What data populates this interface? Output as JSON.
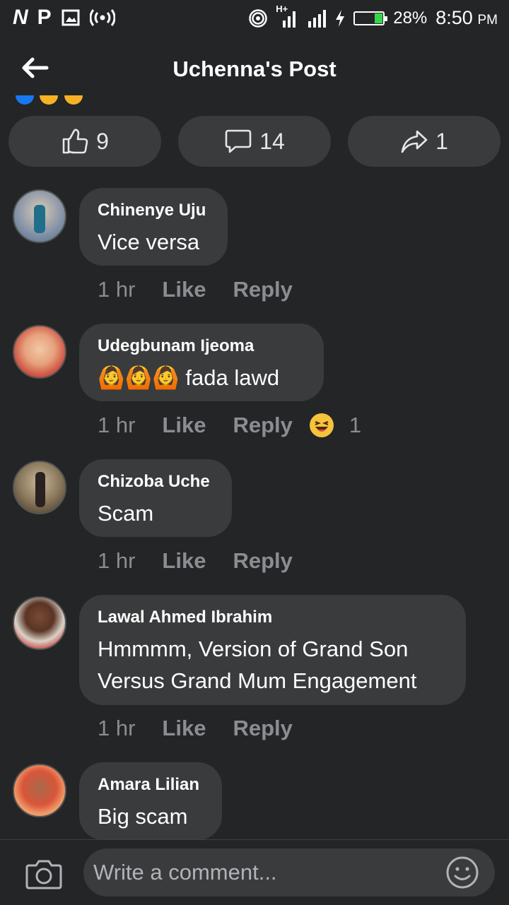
{
  "status": {
    "left_n": "N",
    "left_p": "P",
    "network": "H+",
    "battery": "28%",
    "battery_level": 0.28,
    "time": "8:50",
    "ampm": "PM"
  },
  "header": {
    "title": "Uchenna's Post"
  },
  "actions": {
    "likes": "9",
    "comments": "14",
    "shares": "1"
  },
  "comments": [
    {
      "name": "Chinenye Uju",
      "text": "Vice versa",
      "time": "1 hr",
      "like": "Like",
      "reply": "Reply"
    },
    {
      "name": "Udegbunam Ijeoma",
      "emojis": "🙆🙆🙆",
      "text": "fada lawd",
      "time": "1 hr",
      "like": "Like",
      "reply": "Reply",
      "reaction_count": "1"
    },
    {
      "name": "Chizoba Uche",
      "text": "Scam",
      "time": "1 hr",
      "like": "Like",
      "reply": "Reply"
    },
    {
      "name": "Lawal Ahmed Ibrahim",
      "text_line1": "Hmmmm, Version of Grand Son",
      "text_line2": "Versus Grand Mum Engagement",
      "time": "1 hr",
      "like": "Like",
      "reply": "Reply"
    },
    {
      "name": "Amara Lilian",
      "text": "Big scam"
    }
  ],
  "composer": {
    "placeholder": "Write a comment..."
  }
}
